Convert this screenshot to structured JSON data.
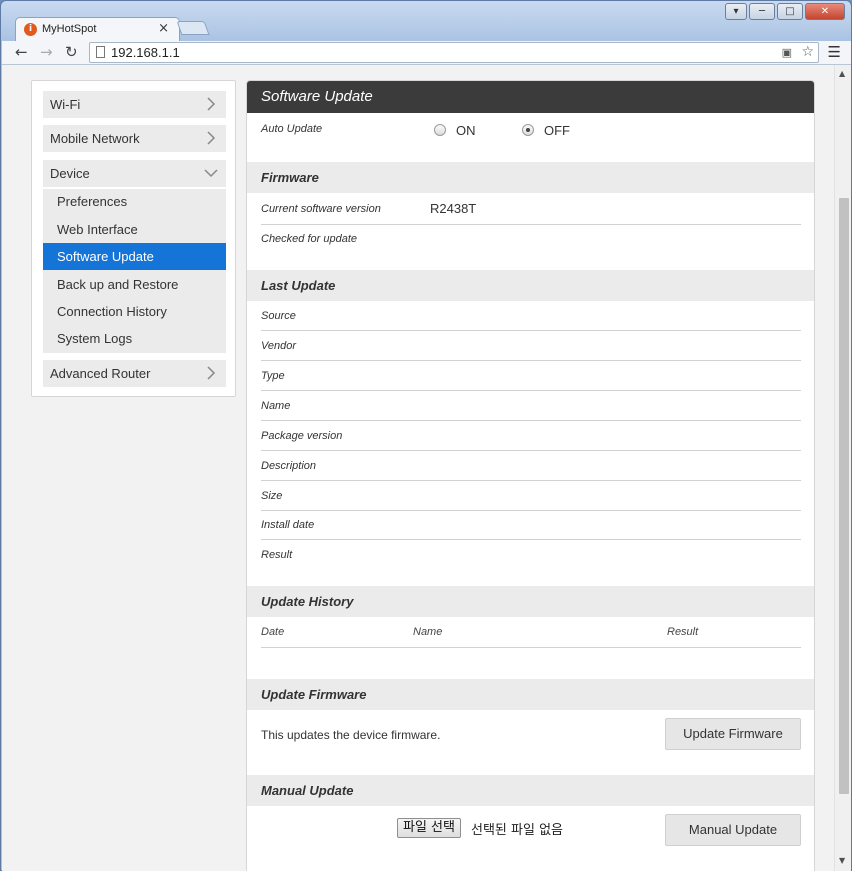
{
  "browser": {
    "tab_title": "MyHotSpot",
    "tab_close": "×",
    "url": "192.168.1.1",
    "favicon_letter": "i"
  },
  "sidebar": {
    "groups": [
      {
        "label": "Wi-Fi"
      },
      {
        "label": "Mobile Network"
      },
      {
        "label": "Device"
      },
      {
        "label": "Advanced Router"
      }
    ],
    "device_items": [
      {
        "label": "Preferences"
      },
      {
        "label": "Web Interface"
      },
      {
        "label": "Software Update",
        "active": true
      },
      {
        "label": "Back up and Restore"
      },
      {
        "label": "Connection History"
      },
      {
        "label": "System Logs"
      }
    ]
  },
  "main": {
    "title": "Software Update",
    "auto_update": {
      "label": "Auto Update",
      "on_label": "ON",
      "off_label": "OFF",
      "selected": "OFF"
    },
    "firmware": {
      "heading": "Firmware",
      "current_version_label": "Current software version",
      "current_version_value": "R2438T",
      "checked_label": "Checked for update"
    },
    "last_update": {
      "heading": "Last Update",
      "fields": [
        "Source",
        "Vendor",
        "Type",
        "Name",
        "Package version",
        "Description",
        "Size",
        "Install date",
        "Result"
      ]
    },
    "update_history": {
      "heading": "Update History",
      "columns": [
        "Date",
        "Name",
        "Result"
      ]
    },
    "update_firmware": {
      "heading": "Update Firmware",
      "description": "This updates the device firmware.",
      "button": "Update Firmware"
    },
    "manual_update": {
      "heading": "Manual Update",
      "file_button": "파일 선택",
      "file_status": "선택된 파일 없음",
      "button": "Manual Update"
    }
  },
  "colors": {
    "accent": "#1474d8",
    "panel_header": "#3b3b3b",
    "section_bg": "#ebebeb"
  }
}
